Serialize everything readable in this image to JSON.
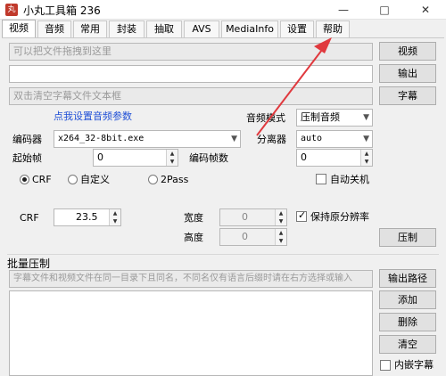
{
  "window": {
    "title": "小丸工具箱 236",
    "icon_text": "丸"
  },
  "tabs": [
    {
      "label": "视频",
      "active": true
    },
    {
      "label": "音频"
    },
    {
      "label": "常用"
    },
    {
      "label": "封装"
    },
    {
      "label": "抽取"
    },
    {
      "label": "AVS"
    },
    {
      "label": "MediaInfo"
    },
    {
      "label": "设置"
    },
    {
      "label": "帮助"
    }
  ],
  "inputs": {
    "video_placeholder": "可以把文件拖拽到这里",
    "output_value": "",
    "subtitle_placeholder": "双击清空字幕文件文本框"
  },
  "buttons": {
    "video": "视频",
    "output": "输出",
    "subtitle": "字幕",
    "compress": "压制",
    "output_path": "输出路径",
    "add": "添加",
    "delete": "删除",
    "clear": "清空"
  },
  "audio": {
    "link": "点我设置音频参数",
    "mode_label": "音频模式",
    "mode_value": "压制音频"
  },
  "encoder": {
    "label": "编码器",
    "value": "x264_32-8bit.exe"
  },
  "splitter": {
    "label": "分离器",
    "value": "auto"
  },
  "start_frame": {
    "label": "起始帧",
    "value": "0"
  },
  "encode_frames": {
    "label": "编码帧数",
    "value": "0"
  },
  "rate_modes": [
    {
      "label": "CRF",
      "selected": true
    },
    {
      "label": "自定义",
      "selected": false
    },
    {
      "label": "2Pass",
      "selected": false
    }
  ],
  "auto_shutdown": {
    "label": "自动关机",
    "checked": false
  },
  "crf": {
    "label": "CRF",
    "value": "23.5"
  },
  "width": {
    "label": "宽度",
    "value": "0"
  },
  "height": {
    "label": "高度",
    "value": "0"
  },
  "keep_resolution": {
    "label": "保持原分辨率",
    "checked": true
  },
  "batch": {
    "title": "批量压制",
    "placeholder": "字幕文件和视频文件在同一目录下且同名，不同名仅有语言后缀时请在右方选择或输入",
    "embed_subtitle_label": "内嵌字幕"
  },
  "colors": {
    "annotation_arrow": "#e0393e",
    "link": "#1f4fd6"
  }
}
